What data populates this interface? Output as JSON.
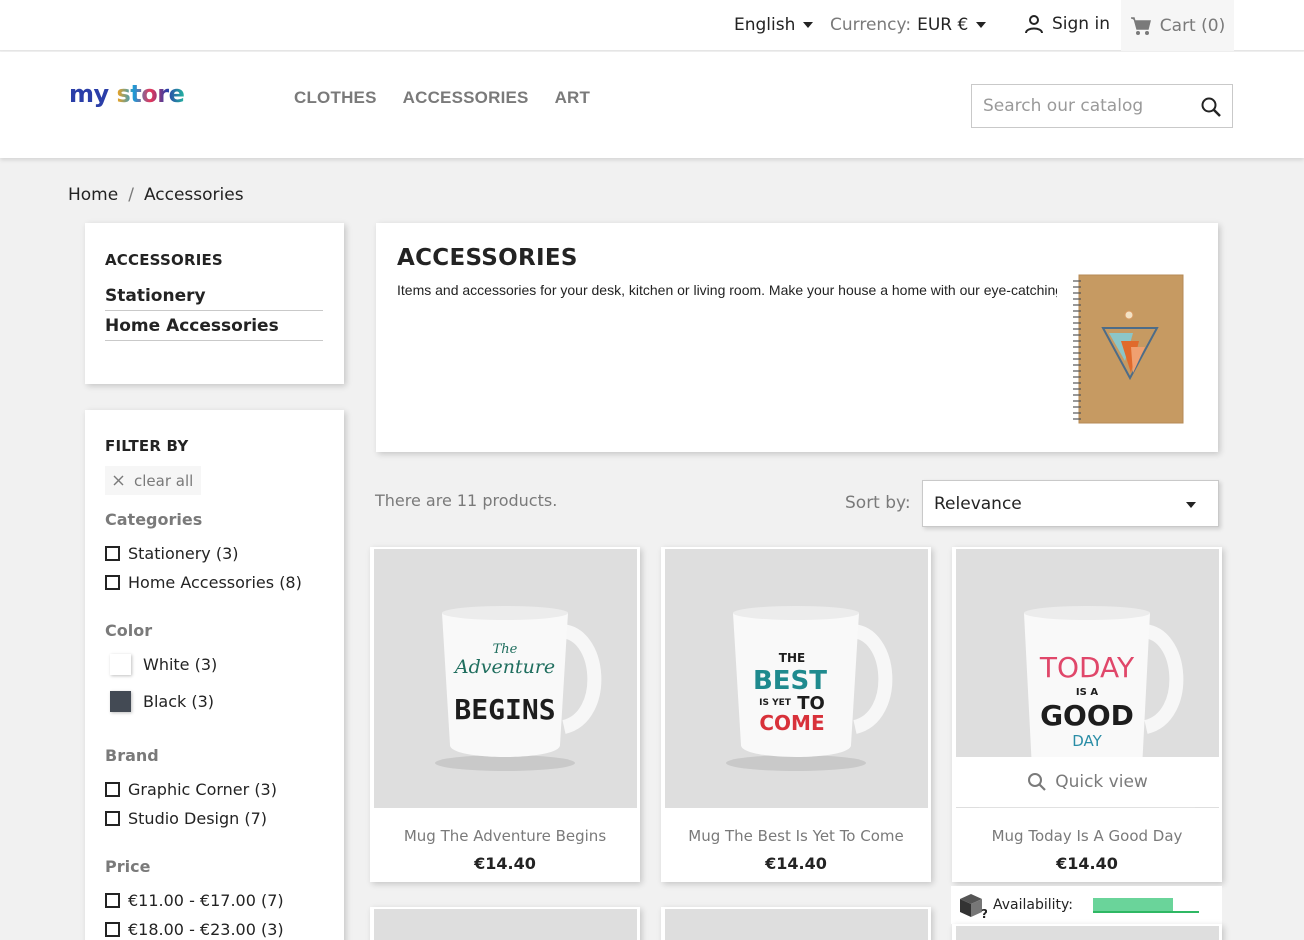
{
  "topbar": {
    "language": "English",
    "currency_label": "Currency:",
    "currency_value": "EUR €",
    "sign_in": "Sign in",
    "cart": "Cart (0)"
  },
  "header": {
    "logo": {
      "my": "my",
      "store": "store"
    },
    "menu": [
      "CLOTHES",
      "ACCESSORIES",
      "ART"
    ],
    "search_placeholder": "Search our catalog"
  },
  "breadcrumb": [
    "Home",
    "/",
    "Accessories"
  ],
  "sidebar": {
    "title": "ACCESSORIES",
    "items": [
      "Stationery",
      "Home Accessories"
    ]
  },
  "filters": {
    "title": "FILTER BY",
    "clear_all": "clear all",
    "categories": {
      "title": "Categories",
      "options": [
        "Stationery (3)",
        "Home Accessories (8)"
      ]
    },
    "color": {
      "title": "Color",
      "options": [
        {
          "label": "White (3)",
          "color": "#ffffff"
        },
        {
          "label": "Black (3)",
          "color": "#434a54"
        }
      ]
    },
    "brand": {
      "title": "Brand",
      "options": [
        "Graphic Corner (3)",
        "Studio Design (7)"
      ]
    },
    "price": {
      "title": "Price",
      "options": [
        "€11.00 - €17.00 (7)",
        "€18.00 - €23.00 (3)"
      ]
    }
  },
  "category": {
    "title": "ACCESSORIES",
    "description": "Items and accessories for your desk, kitchen or living room. Make your house a home with our eye-catching"
  },
  "listing": {
    "count_text": "There are 11 products.",
    "sort_label": "Sort by:",
    "sort_value": "Relevance"
  },
  "products": [
    {
      "name": "Mug The Adventure Begins",
      "price": "€14.40",
      "art": [
        "The",
        "Adventure",
        "BEGINS"
      ]
    },
    {
      "name": "Mug The Best Is Yet To Come",
      "price": "€14.40",
      "art": [
        "THE",
        "BEST",
        "IS YET",
        "TO",
        "COME"
      ]
    },
    {
      "name": "Mug Today Is A Good Day",
      "price": "€14.40",
      "art": [
        "TODAY",
        "IS A",
        "GOOD",
        "DAY"
      ]
    }
  ],
  "quick_view": "Quick view",
  "availability": {
    "label": "Availability:",
    "level": 0.75
  },
  "colors": {
    "accent": "#24b9d7",
    "muted": "#7a7a7a",
    "text": "#232323",
    "availability": "#6ad49a"
  }
}
